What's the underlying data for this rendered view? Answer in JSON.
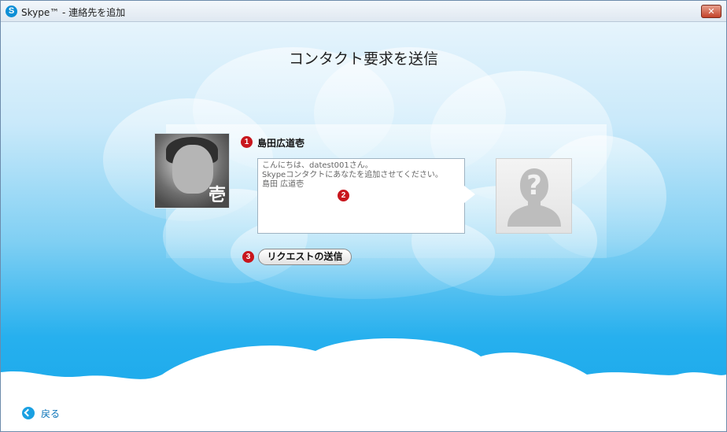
{
  "window": {
    "title": "Skype™ - 連絡先を追加",
    "logo_letter": "S",
    "close_symbol": "✕"
  },
  "page": {
    "heading": "コンタクト要求を送信"
  },
  "contact": {
    "name": "島田広道壱",
    "photo_mark": "壱"
  },
  "message": {
    "text": "こんにちは、datest001さん。\nSkypeコンタクトにあなたを追加させてください。\n島田 広道壱"
  },
  "actions": {
    "send_label": "リクエストの送信",
    "back_label": "戻る"
  },
  "annotations": {
    "badge1": "1",
    "badge2": "2",
    "badge3": "3"
  },
  "icons": {
    "title_logo": "skype-logo-icon",
    "close": "close-icon",
    "back": "back-arrow-icon",
    "placeholder": "unknown-person-icon"
  },
  "colors": {
    "sky_top": "#e6f4fc",
    "sky_bottom": "#15a6ea",
    "badge": "#c8161d",
    "link": "#0a73b8"
  }
}
